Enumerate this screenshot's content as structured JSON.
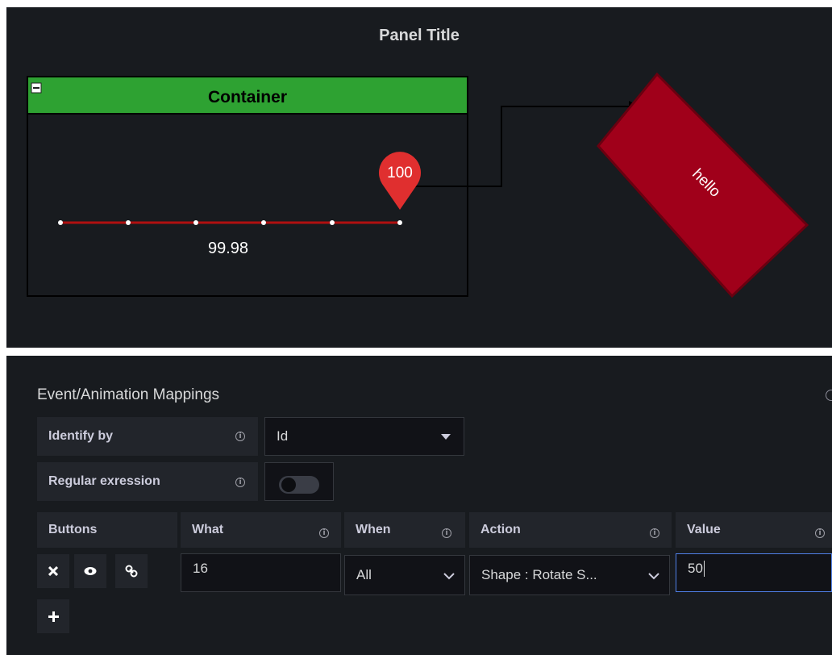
{
  "panel": {
    "title": "Panel Title",
    "container_label": "Container",
    "marker_value": "100",
    "readout_value": "99.98",
    "shape_label": "hello",
    "colors": {
      "background": "#181b1f",
      "container_header": "#2ea232",
      "marker": "#e02f2f",
      "shape": "#a0001a",
      "line": "#b01010"
    }
  },
  "editor": {
    "section_title": "Event/Animation Mappings",
    "identify_by": {
      "label": "Identify by",
      "value": "Id"
    },
    "regular_expression": {
      "label": "Regular exression",
      "enabled": false
    },
    "columns": {
      "buttons": "Buttons",
      "what": "What",
      "when": "When",
      "action": "Action",
      "value": "Value"
    },
    "row": {
      "what": "16",
      "when": "All",
      "action": "Shape : Rotate S...",
      "value": "50"
    },
    "icons": {
      "delete": "close-icon",
      "visibility": "eye-icon",
      "link": "link-icon",
      "add": "plus-icon"
    }
  }
}
